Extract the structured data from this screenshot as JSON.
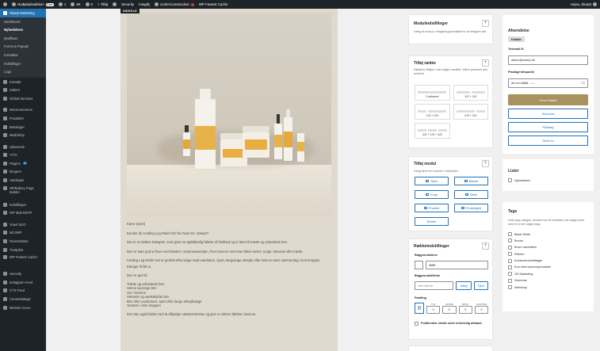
{
  "admin_bar": {
    "site": "Hudplejebutikken",
    "live": "Live",
    "count_a": "1",
    "count_b": "8K",
    "count_c": "0",
    "new": "+ Tilføj",
    "security": "Security",
    "imagify": "Imagify",
    "construction": "UnderConstruction",
    "cache": "WP Fastest Cache",
    "greeting": "Hejsa, Skarpt"
  },
  "sidebar": {
    "top_item": "Skarpt Marketing",
    "submenu": [
      "Dashboard",
      "Nyhedsbrev",
      "Mailflows",
      "Forms & Popups",
      "Kontakter",
      "Indstillinger",
      "Logs"
    ],
    "items": [
      "Kontakt",
      "Salient",
      "Global Sections",
      "WooCommerce",
      "Produkter",
      "Betalinger",
      "Mailchimp",
      "Udseende",
      "YITH",
      "Plugins",
      "Brugere",
      "Værktøjer",
      "WPBakery Page Builder",
      "Indstillinger",
      "WP Mail SMTP",
      "Yoast SEO",
      "MC4WP",
      "FlexHostSite",
      "Trustpilot",
      "WP Fastest Cache",
      "Security",
      "Instagram Feed",
      "CTX Feed",
      "ConsentMagic",
      "Minimer menu"
    ],
    "plugins_badge": "1"
  },
  "editor": {
    "tag": "INDHOLD",
    "body": [
      "Kære {navn}",
      "Kender du Cooling Leg Relief Gel fra Team Dr. Joseph?",
      "Det er en lækker kølegele, som giver en øjeblikkelig følelse af friskhed og er ideel til trætte og udmattede ben.",
      "Den er især god at have ved hånden i sommerperioden, hvor benene nemt kan føles varme, tunge, hævede eller trætte.",
      "Cooling Leg Relief Gel er perfekt efter lange mød-vandsture, sport, langvarige arbejde eller hvis en varm sommerdag, hvor kroppen trænger til lidt ro.",
      "Den er god til:",
      "Trætte og udmattede ben",
      "Varme og tunge ben",
      "Uro i benene",
      "Hævede og væskefyldte ben",
      "Ben efter vandreture, sport eller lange arbejdsdage",
      "Velvære i hele kroppen",
      "Den kan også fuldet med at afhjælpe væskeretention og give en lettere følelse i benene."
    ]
  },
  "module_settings": {
    "title": "Modulindstillinger",
    "desc": "Vælg et modul i redigeringsområdet for at redigere det."
  },
  "add_row": {
    "title": "Tilføj række",
    "desc": "Rækken tilføjes i det valgte område, ellers placeres den nederst.",
    "options": [
      "1 kolonne",
      "1/2 + 1/2",
      "1/3 + 2/3",
      "2/3 + 1/3",
      "1/3 + 1/3 + 1/3"
    ]
  },
  "add_module": {
    "title": "Tilføj modul",
    "desc": "Vælg først en kolonne i indholdet.",
    "buttons": [
      "Tekst",
      "Billede",
      "Knap",
      "Skille",
      "Produkt",
      "Produktgrid",
      "Divider"
    ]
  },
  "row_settings": {
    "title": "Rækkeindstillinger",
    "bg_color_label": "Baggrundsfarve",
    "bg_color": "#ffffff",
    "bg_image_label": "Baggrundsbillede",
    "bg_image_value": "Intet billede",
    "choose": "Vælg",
    "remove": "Fjern",
    "padding_label": "Padding",
    "padding_sides": [
      "TOP",
      "HØJRE",
      "BUND",
      "VENSTRE"
    ],
    "padding_values": [
      "0",
      "0",
      "0",
      "0"
    ],
    "full_width": "Fuldbredde række uden indvendig afstand"
  },
  "send": {
    "title": "Afsendelse",
    "status": "Kladde",
    "test_email_label": "Testmail til",
    "test_email": "admin@skarpt.dk",
    "schedule_label": "Planlagt tidspunkt",
    "schedule_placeholder": "dd.mm.åååå, --:--",
    "save": "Gem Kladde",
    "send_test": "Send test",
    "plan": "Planlæg",
    "send_now": "Send nu"
  },
  "lists": {
    "title": "Lister",
    "items": [
      "Nyhedsbrev"
    ]
  },
  "tags": {
    "title": "Tags",
    "desc": "Hvis tags vælges, sendes kun til kontakter på valgte lister med ét af de valgte tags.",
    "items": [
      "Black Week",
      "Bonus",
      "Brow Lamination",
      "Fillerne",
      "Konkurrencedeltager",
      "Kun med sommerprodukter",
      "OK Marketing",
      "Solcreme",
      "Webshop"
    ]
  },
  "colors": {
    "admin_bar": "#1d2327",
    "sidebar": "#1d2327",
    "accent": "#2271b1",
    "save_button": "#a8925e"
  }
}
